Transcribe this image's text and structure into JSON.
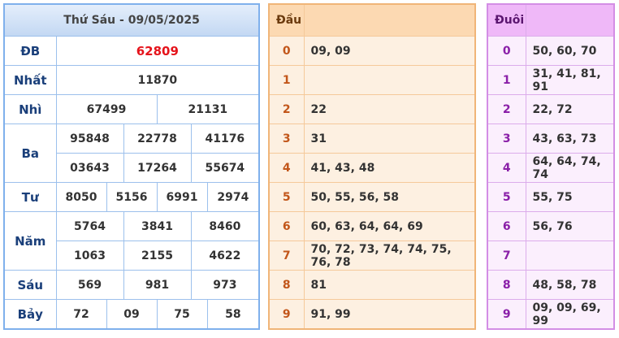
{
  "results": {
    "title": "Thứ Sáu - 09/05/2025",
    "db": {
      "label": "ĐB",
      "values": [
        "62809"
      ]
    },
    "nhat": {
      "label": "Nhất",
      "values": [
        "11870"
      ]
    },
    "nhi": {
      "label": "Nhì",
      "values": [
        "67499",
        "21131"
      ]
    },
    "ba": {
      "label": "Ba",
      "values": [
        "95848",
        "22778",
        "41176",
        "03643",
        "17264",
        "55674"
      ]
    },
    "tu": {
      "label": "Tư",
      "values": [
        "8050",
        "5156",
        "6991",
        "2974"
      ]
    },
    "nam": {
      "label": "Năm",
      "values": [
        "5764",
        "3841",
        "8460",
        "1063",
        "2155",
        "4622"
      ]
    },
    "sau": {
      "label": "Sáu",
      "values": [
        "569",
        "981",
        "973"
      ]
    },
    "bay": {
      "label": "Bảy",
      "values": [
        "72",
        "09",
        "75",
        "58"
      ]
    }
  },
  "head": {
    "header": "Đầu",
    "rows": [
      {
        "key": "0",
        "values": "09, 09"
      },
      {
        "key": "1",
        "values": ""
      },
      {
        "key": "2",
        "values": "22"
      },
      {
        "key": "3",
        "values": "31"
      },
      {
        "key": "4",
        "values": "41, 43, 48"
      },
      {
        "key": "5",
        "values": "50, 55, 56, 58"
      },
      {
        "key": "6",
        "values": "60, 63, 64, 64, 69"
      },
      {
        "key": "7",
        "values": "70, 72, 73, 74, 74, 75, 76, 78"
      },
      {
        "key": "8",
        "values": "81"
      },
      {
        "key": "9",
        "values": "91, 99"
      }
    ]
  },
  "tail": {
    "header": "Đuôi",
    "rows": [
      {
        "key": "0",
        "values": "50, 60, 70"
      },
      {
        "key": "1",
        "values": "31, 41, 81, 91"
      },
      {
        "key": "2",
        "values": "22, 72"
      },
      {
        "key": "3",
        "values": "43, 63, 73"
      },
      {
        "key": "4",
        "values": "64, 64, 74, 74"
      },
      {
        "key": "5",
        "values": "55, 75"
      },
      {
        "key": "6",
        "values": "56, 76"
      },
      {
        "key": "7",
        "values": ""
      },
      {
        "key": "8",
        "values": "48, 58, 78"
      },
      {
        "key": "9",
        "values": "09, 09, 69, 99"
      }
    ]
  }
}
